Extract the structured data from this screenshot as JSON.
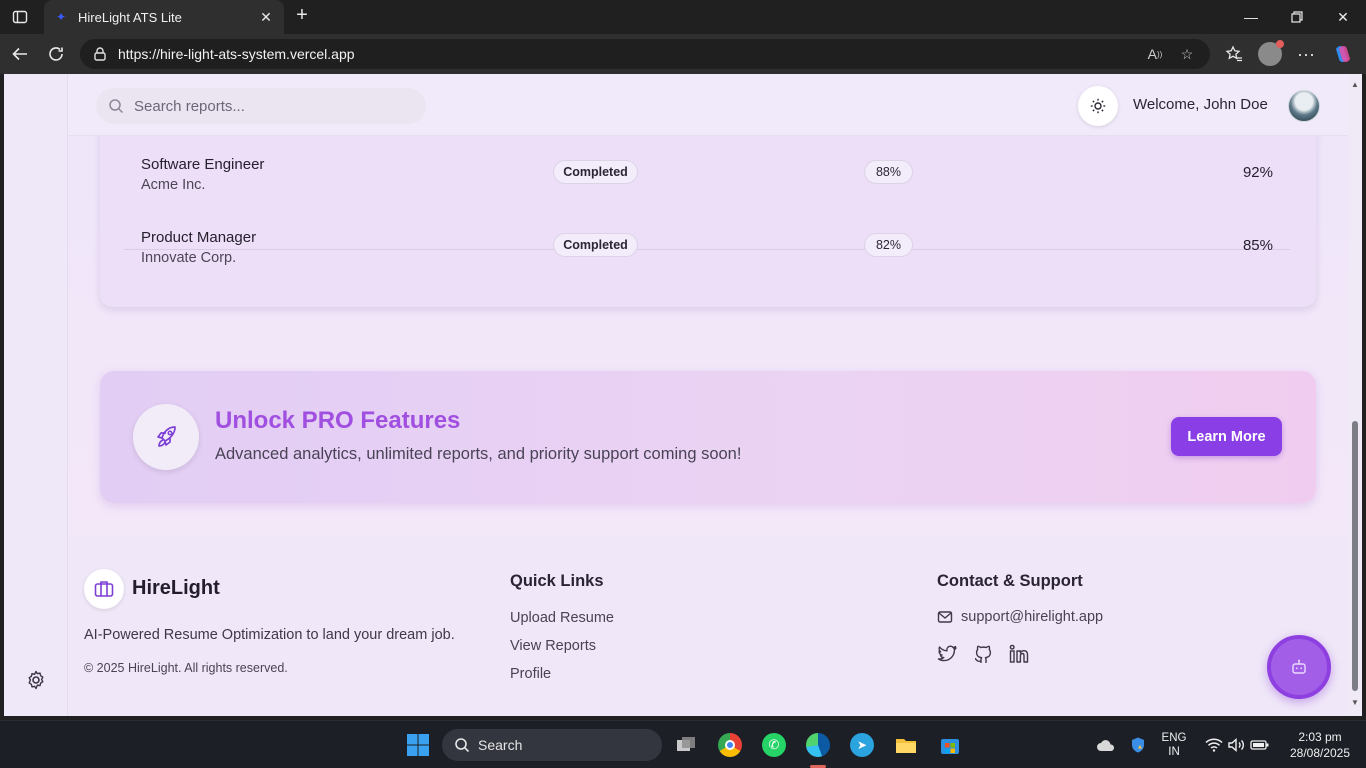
{
  "browser": {
    "tab_title": "HireLight ATS Lite",
    "url": "https://hire-light-ats-system.vercel.app"
  },
  "header": {
    "search_placeholder": "Search reports...",
    "welcome": "Welcome, John Doe"
  },
  "reports": {
    "rows": [
      {
        "role": "Software Engineer",
        "company": "Acme Inc.",
        "status": "Completed",
        "ats_score": "88%",
        "final_score": "92%"
      },
      {
        "role": "Product Manager",
        "company": "Innovate Corp.",
        "status": "Completed",
        "ats_score": "82%",
        "final_score": "85%"
      }
    ]
  },
  "promo": {
    "title": "Unlock PRO Features",
    "subtitle": "Advanced analytics, unlimited reports, and priority support coming soon!",
    "button": "Learn More"
  },
  "footer": {
    "brand": "HireLight",
    "tagline": "AI-Powered Resume Optimization to land your dream job.",
    "copyright": "© 2025 HireLight. All rights reserved.",
    "quick_links_title": "Quick Links",
    "quick_links": [
      "Upload Resume",
      "View Reports",
      "Profile"
    ],
    "contact_title": "Contact & Support",
    "email": "support@hirelight.app",
    "socials": [
      "twitter-icon",
      "github-icon",
      "linkedin-icon"
    ]
  },
  "taskbar": {
    "search_label": "Search",
    "lang_line1": "ENG",
    "lang_line2": "IN",
    "time": "2:03 pm",
    "date": "28/08/2025"
  },
  "colors": {
    "accent": "#8a3fe6",
    "promo_title": "#a04fe0"
  }
}
